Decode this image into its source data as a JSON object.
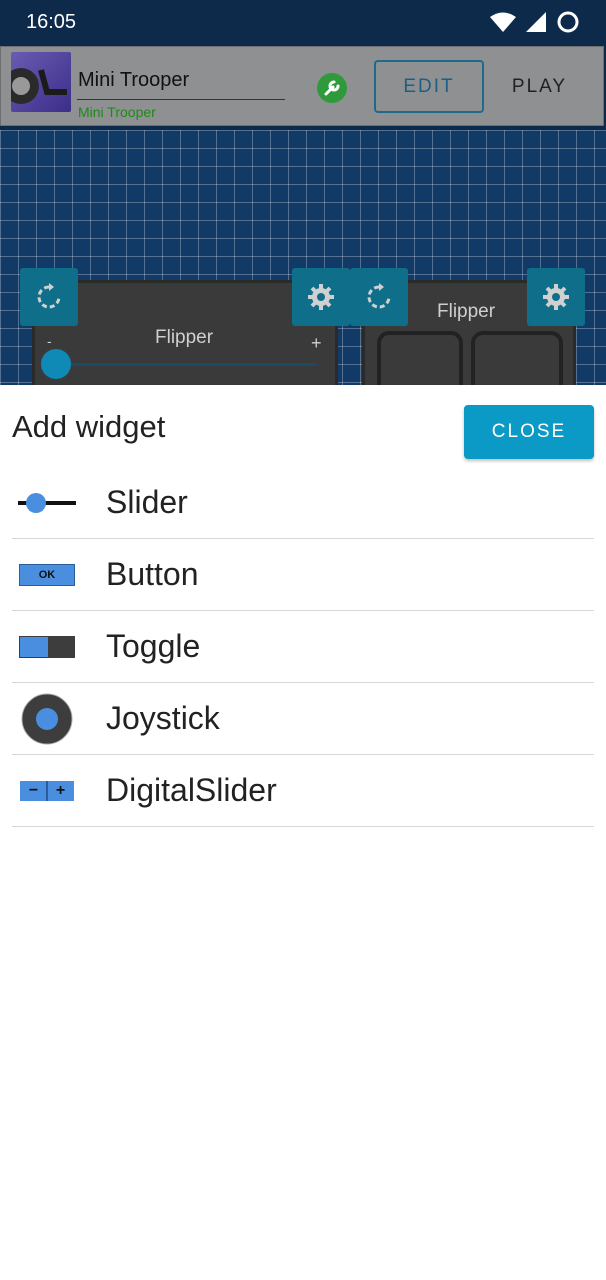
{
  "status": {
    "time": "16:05"
  },
  "toolbar": {
    "robot_name": "Mini Trooper",
    "robot_subtitle": "Mini Trooper",
    "edit_label": "EDIT",
    "play_label": "PLAY"
  },
  "canvas": {
    "widget1_label": "Flipper",
    "widget1_minus": "-",
    "widget1_plus": "+",
    "widget2_label": "Flipper"
  },
  "dialog": {
    "title": "Add widget",
    "close_label": "CLOSE",
    "items": [
      {
        "label": "Slider",
        "icon": "slider-icon"
      },
      {
        "label": "Button",
        "icon": "button-icon",
        "icon_text": "OK"
      },
      {
        "label": "Toggle",
        "icon": "toggle-icon"
      },
      {
        "label": "Joystick",
        "icon": "joystick-icon"
      },
      {
        "label": "DigitalSlider",
        "icon": "digital-slider-icon",
        "icon_text_minus": "−",
        "icon_text_plus": "+"
      }
    ]
  },
  "colors": {
    "accent": "#0b99c6",
    "widget_blue": "#4a8fdf",
    "grid_bg": "#123a66"
  }
}
